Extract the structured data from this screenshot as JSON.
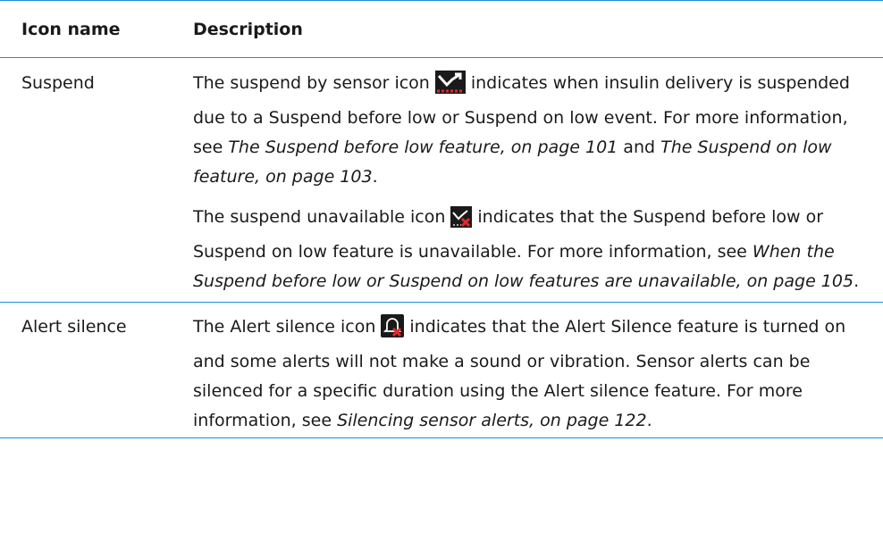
{
  "headers": {
    "col1": "Icon name",
    "col2": "Description"
  },
  "rows": [
    {
      "name": "Suspend",
      "p1": {
        "before": "The suspend by sensor icon",
        "icon": "suspend-by-sensor-icon",
        "after": "indicates when insulin delivery is suspended due to a Suspend before low or Suspend on low event. For more information, see",
        "ref1": "The Suspend before low feature, on page 101",
        "and": "and",
        "ref2": "The Suspend on low feature, on page 103",
        "end": "."
      },
      "p2": {
        "before": "The suspend unavailable icon",
        "icon": "suspend-unavailable-icon",
        "after": "indicates that the Suspend before low or Suspend on low feature is unavailable. For more information, see",
        "ref": "When the Suspend before low or Suspend on low features are unavailable, on page 105",
        "end": "."
      }
    },
    {
      "name": "Alert silence",
      "p1": {
        "before": "The Alert silence icon",
        "icon": "alert-silence-icon",
        "after": "indicates that the Alert Silence feature is turned on and some alerts will not make a sound or vibration. Sensor alerts can be silenced for a specific duration using the Alert silence feature. For more information, see",
        "ref": "Silencing sensor alerts, on page 122",
        "end": "."
      }
    }
  ],
  "colors": {
    "rule": "#1e90d6",
    "icon_red": "#e8262c",
    "icon_dark": "#1a1a1a"
  }
}
